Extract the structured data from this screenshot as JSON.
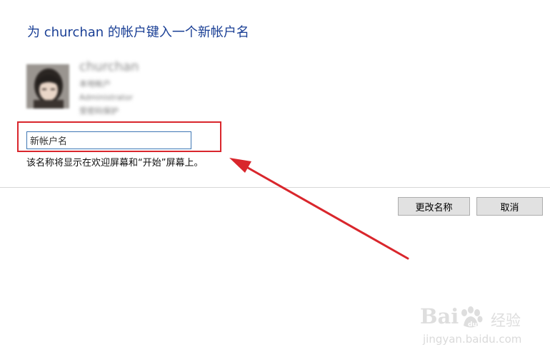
{
  "dialog": {
    "title": "为 churchan 的帐户键入一个新帐户名"
  },
  "profile": {
    "name": "churchan",
    "account_type": "本地帐户",
    "role": "Administrator",
    "password_status": "受密码保护"
  },
  "rename_field": {
    "value": "新帐户名"
  },
  "hint_text": "该名称将显示在欢迎屏幕和“开始”屏幕上。",
  "buttons": {
    "rename": "更改名称",
    "cancel": "取消"
  },
  "annotation": {
    "color": "#d9262c"
  },
  "watermark": {
    "brand": "Bai",
    "brand_suffix": "经验",
    "url": "jingyan.baidu.com"
  },
  "colors": {
    "title": "#1a3f95",
    "input_border": "#3f77b4",
    "button_bg": "#e1e1e1"
  }
}
